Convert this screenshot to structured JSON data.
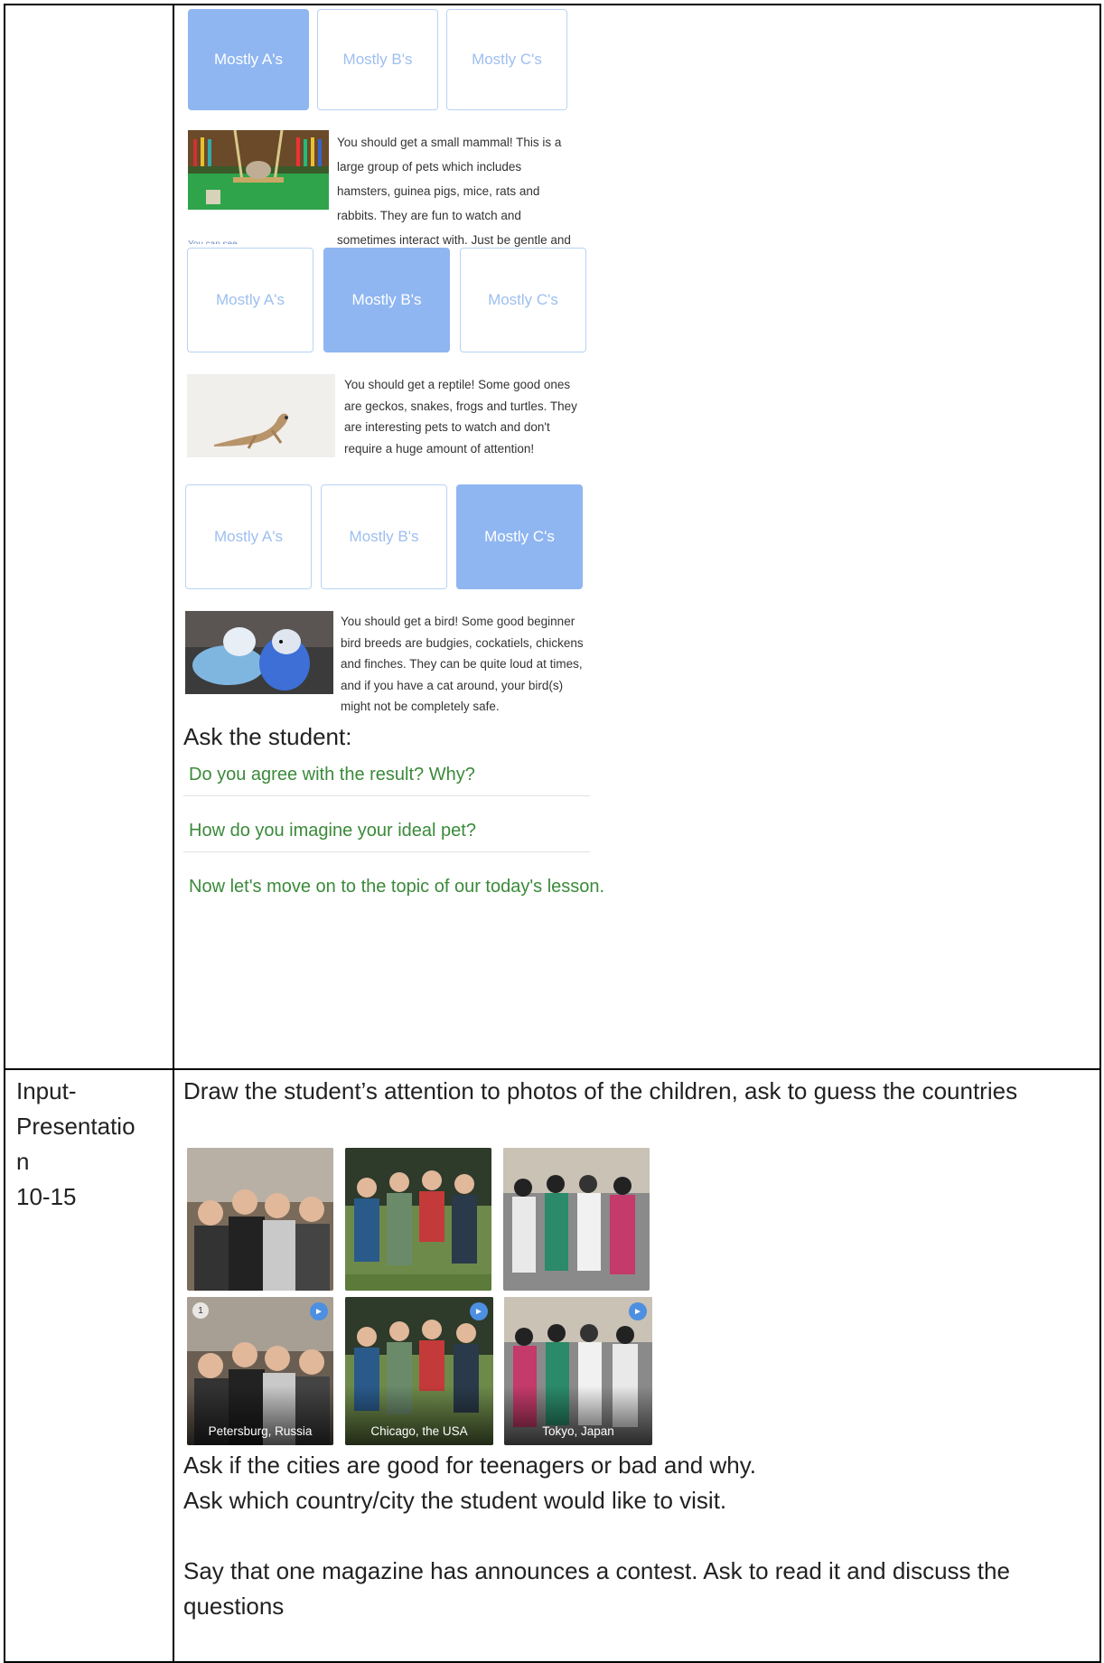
{
  "quiz": {
    "blocks": [
      {
        "options": [
          "Mostly A's",
          "Mostly B's",
          "Mostly C's"
        ],
        "selected": 0,
        "result": "You should get a small mammal! This is a large group of pets which includes hamsters, guinea pigs, mice, rats and rabbits. They are fun to watch and sometimes interact with. Just be gentle and you won't get a bite!",
        "image": "hamster-photo",
        "cut_text": "You can see..."
      },
      {
        "options": [
          "Mostly A's",
          "Mostly B's",
          "Mostly C's"
        ],
        "selected": 1,
        "result": "You should get a reptile! Some good ones are geckos, snakes, frogs and turtles. They are interesting pets to watch and don't require a huge amount of attention!",
        "image": "gecko-photo"
      },
      {
        "options": [
          "Mostly A's",
          "Mostly B's",
          "Mostly C's"
        ],
        "selected": 2,
        "result": "You should get a bird! Some good beginner bird breeds are budgies, cockatiels, chickens and finches. They can be quite loud at times, and if you have a cat around, your bird(s) might not be completely safe.",
        "image": "budgies-photo"
      }
    ]
  },
  "ask_student": {
    "heading": "Ask the student:",
    "questions": [
      "Do you agree with the result? Why?",
      "How do you imagine your ideal pet?",
      "Now let's move on to the topic of our today's lesson."
    ]
  },
  "stage": {
    "line1": "Input-",
    "line2": "Presentatio",
    "line3": "n",
    "line4": "10-15"
  },
  "presentation": {
    "intro": "Draw the student’s attention to photos of the children, ask to guess the countries",
    "photos_top": [
      "group-photo-russia",
      "group-photo-usa",
      "group-photo-japan"
    ],
    "photos_bottom": [
      {
        "caption": "Petersburg, Russia",
        "number": "1"
      },
      {
        "caption": "Chicago, the USA"
      },
      {
        "caption": "Tokyo, Japan"
      }
    ],
    "line_a": "Ask if the cities are good for teenagers or bad and why.",
    "line_b": "Ask which country/city the student would like to visit.",
    "line_c": "Say that one magazine has announces a contest. Ask to read it and discuss the questions"
  }
}
